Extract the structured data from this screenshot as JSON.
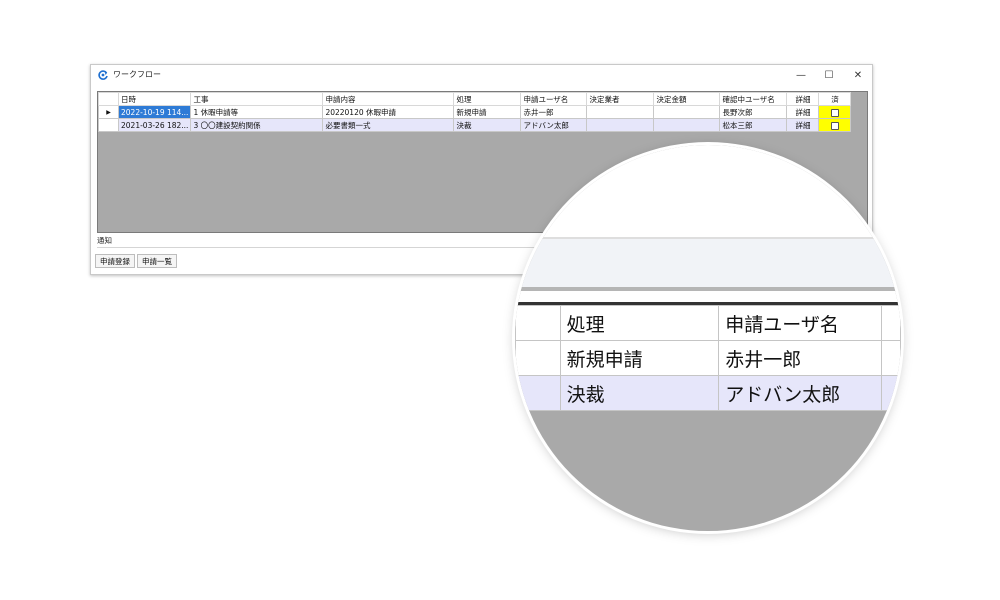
{
  "window": {
    "title": "ワークフロー",
    "minimize": "—",
    "maximize": "☐",
    "close": "✕"
  },
  "grid": {
    "row_marker": "▶",
    "columns": [
      "日時",
      "工事",
      "申請内容",
      "処理",
      "申請ユーザ名",
      "決定業者",
      "決定金額",
      "確認中ユーザ名",
      "詳細",
      "済"
    ],
    "rows": [
      {
        "date": "2022-10-19 114...",
        "project": "1 休暇申請等",
        "content": "20220120 休暇申請",
        "process": "新規申請",
        "applicant": "赤井一郎",
        "vendor": "",
        "amount": "",
        "confirmer": "長野次郎",
        "detail": "詳細",
        "done": false
      },
      {
        "date": "2021-03-26 182...",
        "project": "3 〇〇建設契約関係",
        "content": "必要書類一式",
        "process": "決裁",
        "applicant": "アドバン太郎",
        "vendor": "",
        "amount": "",
        "confirmer": "松本三郎",
        "detail": "詳細",
        "done": false
      }
    ]
  },
  "notice_label": "通知",
  "buttons": {
    "register": "申請登録",
    "list": "申請一覧"
  },
  "magnifier": {
    "headers": [
      "処理",
      "申請ユーザ名"
    ],
    "rows": [
      [
        "新規申請",
        "赤井一郎"
      ],
      [
        "決裁",
        "アドバン太郎"
      ]
    ]
  },
  "colors": {
    "selected": "#2e7bd6",
    "alt_row": "#e6e6fa",
    "done_cell": "#ffff00",
    "grid_bg": "#a9a9a9",
    "accent_icon": "#1e6fd0"
  }
}
